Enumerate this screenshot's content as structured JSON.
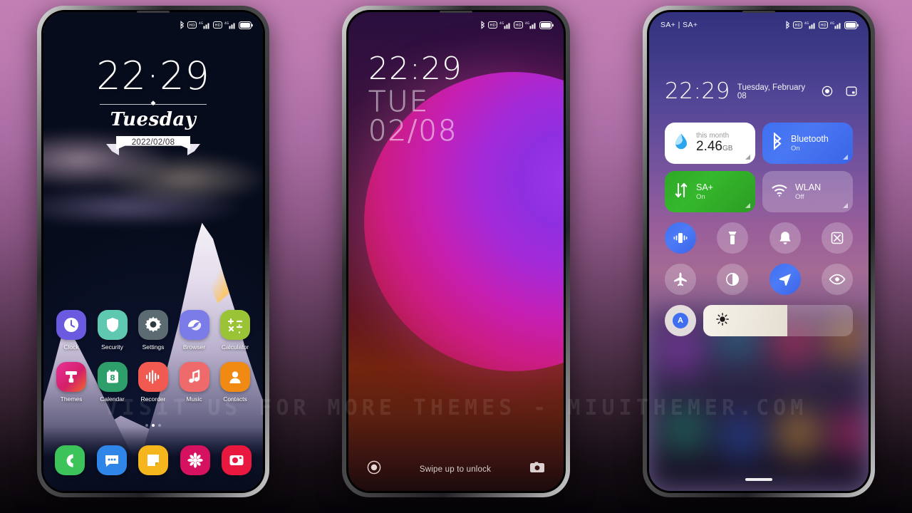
{
  "watermark": "VISIT  US  FOR  MORE  THEMES  -  MIUITHEMER.COM",
  "phone1": {
    "name": "lock-home-screen",
    "statusbar": {
      "left": "",
      "icons": [
        "bluetooth-icon",
        "hd-icon",
        "4g-signal-icon",
        "hd-icon",
        "4g-signal-icon",
        "battery-icon"
      ]
    },
    "clock": {
      "time": "22·29",
      "weekday": "Tuesday",
      "date": "2022/02/08"
    },
    "apps_row1": [
      {
        "label": "Clock",
        "icon": "clock-icon",
        "color": "#6a5ae0"
      },
      {
        "label": "Security",
        "icon": "shield-icon",
        "color": "#5ec9b0"
      },
      {
        "label": "Settings",
        "icon": "gear-icon",
        "color": "#5c6b72"
      },
      {
        "label": "Browser",
        "icon": "browser-icon",
        "color": "#7b7ce8"
      },
      {
        "label": "Calculator",
        "icon": "calculator-icon",
        "color": "#9ac436"
      }
    ],
    "apps_row2": [
      {
        "label": "Themes",
        "icon": "themes-icon",
        "color": "#e0317f"
      },
      {
        "label": "Calendar",
        "icon": "calendar-icon",
        "color": "#2e9e6b"
      },
      {
        "label": "Recorder",
        "icon": "recorder-icon",
        "color": "#f05a50"
      },
      {
        "label": "Music",
        "icon": "music-icon",
        "color": "#ef6a6a"
      },
      {
        "label": "Contacts",
        "icon": "contacts-icon",
        "color": "#f08a12"
      }
    ],
    "page_dots": {
      "count": 3,
      "active": 2
    },
    "dock": [
      {
        "label": "Phone",
        "icon": "phone-icon",
        "color": "#3cc35a"
      },
      {
        "label": "Messages",
        "icon": "message-icon",
        "color": "#2f86e8"
      },
      {
        "label": "Notes",
        "icon": "notes-icon",
        "color": "#f5b51c"
      },
      {
        "label": "Gallery",
        "icon": "gallery-icon",
        "color": "#d6115f"
      },
      {
        "label": "Camera",
        "icon": "camera-icon",
        "color": "#e8183f"
      }
    ]
  },
  "phone2": {
    "name": "lock-screen",
    "statusbar": {
      "icons": [
        "bluetooth-icon",
        "hd-icon",
        "4g-signal-icon",
        "hd-icon",
        "4g-signal-icon",
        "battery-icon"
      ]
    },
    "clock": {
      "time": "22:29",
      "weekday": "TUE",
      "date": "02/08"
    },
    "bottom": {
      "left_icon": "record-dot-icon",
      "hint": "Swipe up to unlock",
      "right_icon": "camera-icon"
    }
  },
  "phone3": {
    "name": "control-center",
    "statusbar": {
      "left": "SA+ | SA+",
      "icons": [
        "bluetooth-icon",
        "hd-icon",
        "4g-signal-icon",
        "hd-icon",
        "4g-signal-icon",
        "battery-icon"
      ]
    },
    "header": {
      "time": "22:29",
      "date": "Tuesday, February 08",
      "settings_icon": "settings-target-icon",
      "edit_icon": "edit-panel-icon"
    },
    "tiles_row1": [
      {
        "name": "data-usage",
        "title": "this month",
        "value": "2.46",
        "unit": "GB",
        "icon": "data-drop-icon",
        "state": "light"
      },
      {
        "name": "bluetooth",
        "title": "Bluetooth",
        "subtitle": "On",
        "icon": "bluetooth-icon",
        "state": "on"
      }
    ],
    "tiles_row2": [
      {
        "name": "mobile-data",
        "title": "SA+",
        "subtitle": "On",
        "icon": "data-arrows-icon",
        "state": "on"
      },
      {
        "name": "wlan",
        "title": "WLAN",
        "subtitle": "Off",
        "icon": "wifi-icon",
        "state": "off"
      }
    ],
    "toggles_row1": [
      {
        "name": "vibrate",
        "icon": "vibrate-icon",
        "state": "on"
      },
      {
        "name": "flashlight",
        "icon": "flashlight-icon",
        "state": "off"
      },
      {
        "name": "ring",
        "icon": "bell-icon",
        "state": "off"
      },
      {
        "name": "screenshot",
        "icon": "screenshot-icon",
        "state": "off"
      }
    ],
    "toggles_row2": [
      {
        "name": "airplane-mode",
        "icon": "airplane-icon",
        "state": "off"
      },
      {
        "name": "dark-mode",
        "icon": "contrast-icon",
        "state": "off"
      },
      {
        "name": "location",
        "icon": "location-icon",
        "state": "on"
      },
      {
        "name": "eye-protection",
        "icon": "eye-icon",
        "state": "off"
      }
    ],
    "brightness": {
      "auto_label": "A",
      "icon": "brightness-sun-icon",
      "level_percent": 56
    }
  }
}
